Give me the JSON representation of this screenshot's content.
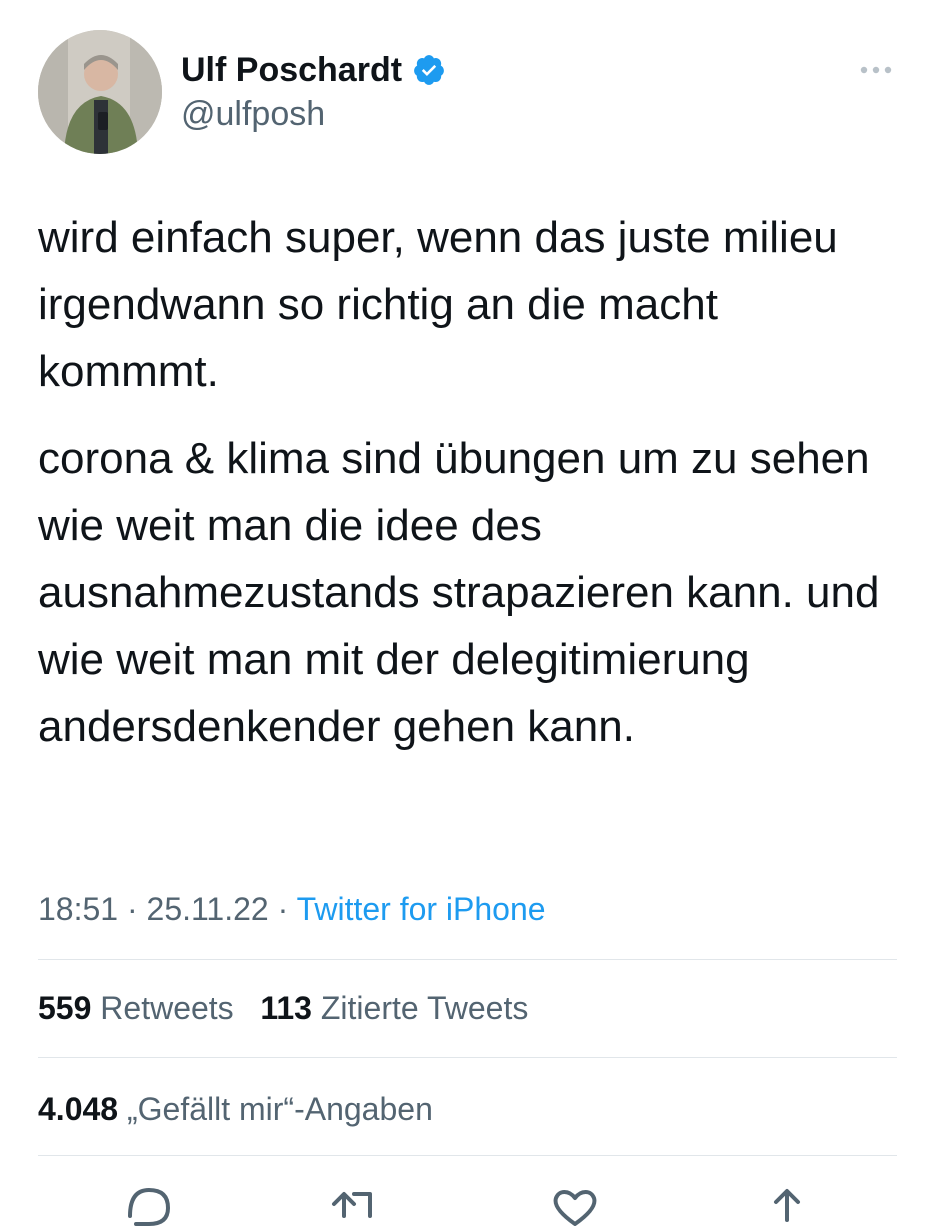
{
  "author": {
    "display_name": "Ulf Poschardt",
    "handle": "@ulfposh"
  },
  "tweet": {
    "paragraphs": [
      "wird einfach super, wenn das juste milieu irgendwann so richtig an die macht kommmt.",
      "corona & klima sind übungen um zu sehen wie weit man die idee des ausnahmezustands strapazieren kann. und wie weit man mit der delegitimierung andersdenkender gehen kann."
    ],
    "time": "18:51",
    "separator": "·",
    "date": "25.11.22",
    "source": "Twitter for iPhone"
  },
  "stats": {
    "retweets": {
      "count": "559",
      "label": "Retweets"
    },
    "quotes": {
      "count": "113",
      "label": "Zitierte Tweets"
    },
    "likes": {
      "count": "4.048",
      "label": "„Gefällt mir“-Angaben"
    }
  },
  "icons": {
    "verified": "verified-badge-icon",
    "more": "more-options-icon",
    "reply": "reply-icon",
    "retweet": "retweet-icon",
    "like": "heart-icon",
    "share": "share-icon"
  },
  "colors": {
    "accent": "#1d9bf0",
    "text": "#0f1419",
    "secondary": "#536471",
    "divider": "#e1e6ea"
  }
}
